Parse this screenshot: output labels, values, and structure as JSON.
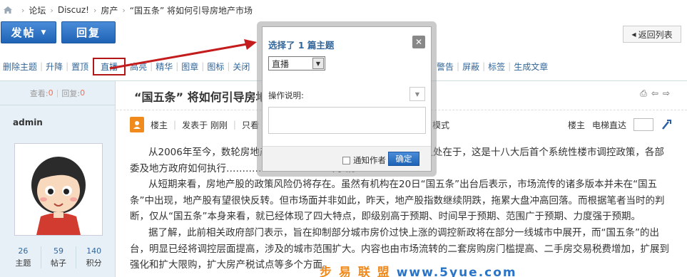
{
  "breadcrumb": {
    "items": [
      "论坛",
      "Discuz!",
      "房产",
      "“国五条” 将如何引导房地产市场"
    ],
    "separator": "›"
  },
  "buttons": {
    "post": "发帖",
    "reply": "回复",
    "back": "返回列表"
  },
  "modbar": {
    "left_items": [
      "删除主题",
      "升降",
      "置顶"
    ],
    "highlighted": "直播",
    "mid_items": [
      "高亮",
      "精华",
      "图章",
      "图标",
      "关闭"
    ],
    "right_items": [
      "警告",
      "屏蔽",
      "标签",
      "生成文章"
    ]
  },
  "thread": {
    "views_label": "查看:",
    "views": "0",
    "replies_label": "回复:",
    "replies": "0",
    "title": "“国五条” 将如何引导房地产市场"
  },
  "author": {
    "name": "admin",
    "stats": [
      {
        "value": "26",
        "label": "主题"
      },
      {
        "value": "59",
        "label": "帖子"
      },
      {
        "value": "140",
        "label": "积分"
      }
    ]
  },
  "postinfo": {
    "floor": "楼主",
    "posted": "发表于 刚刚",
    "only_view": "只看",
    "mode": "模式",
    "floor_right": "楼主",
    "jump_label": "电梯直达"
  },
  "content": {
    "paragraphs": [
      "从2006年至今，数轮房地产调控政策…………………………不同之处在于，这是十八大后首个系统性楼市调控政策，各部委及地方政府如何执行……………………………判断。",
      "从短期来看，房地产股的政策风险仍将存在。虽然有机构在20日“国五条”出台后表示，市场流传的诸多版本并未在“国五条”中出现，地产股有望很快反转。但市场面并非如此，昨天，地产股指数继续阴跌，拖累大盘冲高回落。而根据笔者当时的判断，仅从“国五条”本身来看，就已经体现了四大特点，即级别高于预期、时间早于预期、范围广于预期、力度强于预期。",
      "据了解，此前相关政府部门表示，旨在抑制部分城市房价过快上涨的调控新政将在部分一线城市中展开，而“国五条”的出台，明显已经将调控层面提高，涉及的城市范围扩大。内容也由市场流转的二套房购房门槛提高、二手房交易税费增加，扩展到强化和扩大限购，扩大房产税试点等多个方面。"
    ]
  },
  "modal": {
    "title": "选择了 1 篇主题",
    "select_value": "直播",
    "op_label": "操作说明:",
    "notify_label": "通知作者",
    "confirm": "确定"
  },
  "watermark": {
    "text": "步 易 联 盟",
    "domain": "www.5yue.com"
  }
}
